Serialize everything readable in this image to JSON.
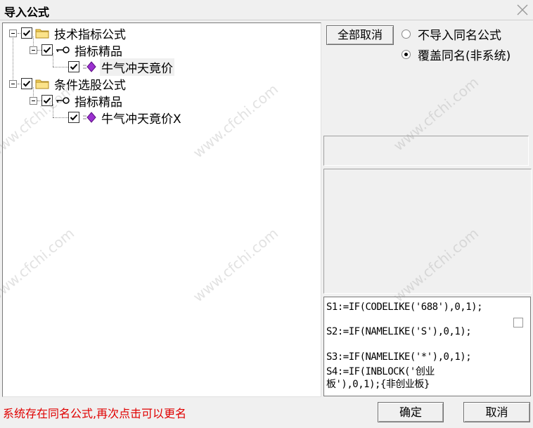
{
  "window": {
    "title": "导入公式"
  },
  "tree": {
    "items": [
      {
        "label": "技术指标公式"
      },
      {
        "label": "指标精品"
      },
      {
        "label": "牛气冲天竟价"
      },
      {
        "label": "条件选股公式"
      },
      {
        "label": "指标精品"
      },
      {
        "label": "牛气冲天竟价X"
      }
    ]
  },
  "options": {
    "deselect_all_label": "全部取消",
    "radio_no_import": "不导入同名公式",
    "radio_overwrite": "覆盖同名(非系统)",
    "selected": "radio_overwrite"
  },
  "code": {
    "lines": [
      "S1:=IF(CODELIKE('688'),0,1);",
      "S2:=IF(NAMELIKE('S'),0,1);",
      "S3:=IF(NAMELIKE('*'),0,1);",
      "S4:=IF(INBLOCK('创业",
      "板'),0,1);{非创业板}"
    ]
  },
  "footer": {
    "status": "系统存在同名公式,再次点击可以更名",
    "ok_label": "确定",
    "cancel_label": "取消"
  },
  "watermark_text": "www.cfchi.com",
  "colors": {
    "status_red": "#e00000",
    "folder_yellow": "#f5d35a",
    "gem_purple": "#9b30d0"
  }
}
